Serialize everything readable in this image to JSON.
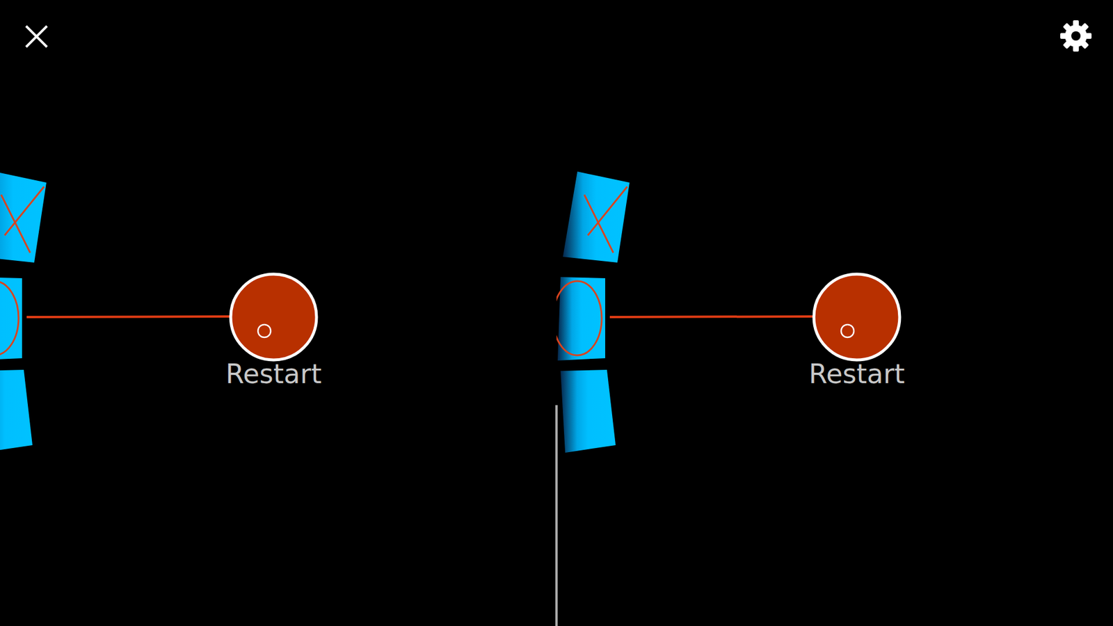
{
  "board": {
    "cells": [
      {
        "mark": "x"
      },
      {
        "mark": "o"
      },
      {
        "mark": "none"
      }
    ]
  },
  "restart": {
    "label": "Restart"
  }
}
